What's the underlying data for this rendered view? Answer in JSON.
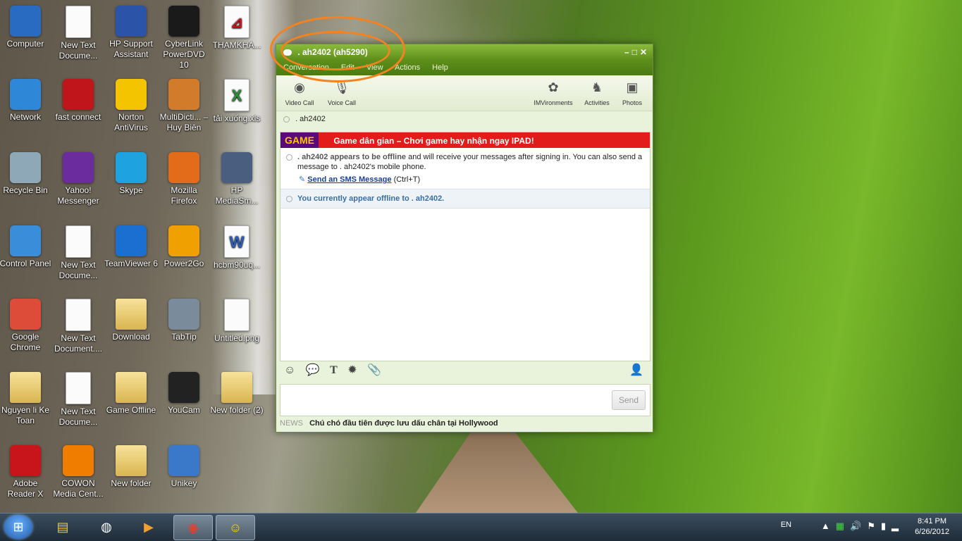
{
  "desktop": {
    "icons": [
      {
        "label": "Computer",
        "icon": "computer-icon",
        "color": "#2a6bc2"
      },
      {
        "label": "New Text Docume...",
        "icon": "text-document-icon",
        "color": "#fbfbfb"
      },
      {
        "label": "HP Support Assistant",
        "icon": "hp-support-icon",
        "color": "#2b54a8"
      },
      {
        "label": "CyberLink PowerDVD 10",
        "icon": "powerdvd-icon",
        "color": "#1a1a1a"
      },
      {
        "label": "THAMKHA...",
        "icon": "pdf-document-icon",
        "color": "#fbfbfb"
      },
      {
        "label": "Network",
        "icon": "network-icon",
        "color": "#2f87d8"
      },
      {
        "label": "fast connect",
        "icon": "fast-connect-icon",
        "color": "#c0161b"
      },
      {
        "label": "Norton AntiVirus",
        "icon": "norton-icon",
        "color": "#f5c400"
      },
      {
        "label": "MultiDicti... – Huy Biên",
        "icon": "multidictionary-icon",
        "color": "#d27b2a"
      },
      {
        "label": "tải xuống.xls",
        "icon": "excel-file-icon",
        "color": "#2e8b3a"
      },
      {
        "label": "Recycle Bin",
        "icon": "recycle-bin-icon",
        "color": "#8fa8b8"
      },
      {
        "label": "Yahoo! Messenger",
        "icon": "yahoo-messenger-icon",
        "color": "#6b2c9e"
      },
      {
        "label": "Skype",
        "icon": "skype-icon",
        "color": "#1ea2e0"
      },
      {
        "label": "Mozilla Firefox",
        "icon": "firefox-icon",
        "color": "#e36c1b"
      },
      {
        "label": "HP MediaSm...",
        "icon": "hp-mediasmart-icon",
        "color": "#4a5e80"
      },
      {
        "label": "Control Panel",
        "icon": "control-panel-icon",
        "color": "#3a8dd8"
      },
      {
        "label": "New Text Docume...",
        "icon": "text-document-icon",
        "color": "#fbfbfb"
      },
      {
        "label": "TeamViewer 6",
        "icon": "teamviewer-icon",
        "color": "#1b6fd1"
      },
      {
        "label": "Power2Go",
        "icon": "power2go-icon",
        "color": "#f0a000"
      },
      {
        "label": "hcbm90uq...",
        "icon": "word-file-icon",
        "color": "#2b5cb8"
      },
      {
        "label": "Google Chrome",
        "icon": "chrome-icon",
        "color": "#dd4b39"
      },
      {
        "label": "New Text Document....",
        "icon": "text-document-icon",
        "color": "#fbfbfb"
      },
      {
        "label": "Download",
        "icon": "folder-icon",
        "color": "#e5c560"
      },
      {
        "label": "TabTip",
        "icon": "tabtip-icon",
        "color": "#7a8c9c"
      },
      {
        "label": "Untitled.png",
        "icon": "image-file-icon",
        "color": "#f0f0f0"
      },
      {
        "label": "Nguyen li Ke Toan",
        "icon": "folder-icon",
        "color": "#e5c560"
      },
      {
        "label": "New Text Docume...",
        "icon": "text-document-icon",
        "color": "#fbfbfb"
      },
      {
        "label": "Game Offline",
        "icon": "folder-icon",
        "color": "#e5c560"
      },
      {
        "label": "YouCam",
        "icon": "youcam-icon",
        "color": "#222222"
      },
      {
        "label": "New folder (2)",
        "icon": "folder-icon",
        "color": "#e5c560"
      },
      {
        "label": "Adobe Reader X",
        "icon": "adobe-reader-icon",
        "color": "#c8141b"
      },
      {
        "label": "COWON Media Cent...",
        "icon": "cowon-icon",
        "color": "#f07d00"
      },
      {
        "label": "New folder",
        "icon": "folder-icon",
        "color": "#e5c560"
      },
      {
        "label": "Unikey",
        "icon": "unikey-icon",
        "color": "#3a78c9"
      }
    ]
  },
  "messenger": {
    "title": ". ah2402 (ah5290)",
    "menu": [
      "Conversation",
      "Edit",
      "View",
      "Actions",
      "Help"
    ],
    "toolbar": {
      "video_call": "Video Call",
      "voice_call": "Voice Call",
      "imvironments": "IMVironments",
      "activities": "Activities",
      "photos": "Photos"
    },
    "contact_name": ". ah2402",
    "ad": {
      "logo": "GAME",
      "text": "Game dân gian – Chơi game hay nhận ngay IPAD!"
    },
    "offline_notice": {
      "name_part": ". ah2402 appears to be offline",
      "rest": " and will receive your messages after signing in. You can also send a message to . ah2402's mobile phone.",
      "sms_link": "Send an SMS Message",
      "sms_shortcut": "(Ctrl+T)"
    },
    "status_line": "You currently appear offline to . ah2402.",
    "input": {
      "value": "",
      "placeholder": ""
    },
    "send_label": "Send",
    "news": {
      "label": "NEWS",
      "text": "Chú chó đầu tiên được lưu dấu chân tại Hollywood"
    }
  },
  "taskbar": {
    "start_label": "Start",
    "items": [
      {
        "icon": "windows-explorer-icon",
        "active": false
      },
      {
        "icon": "ea-games-icon",
        "active": false
      },
      {
        "icon": "media-player-icon",
        "active": false
      },
      {
        "icon": "chrome-icon",
        "active": true
      },
      {
        "icon": "yahoo-messenger-icon",
        "active": true
      }
    ],
    "language": "EN",
    "time": "8:41 PM",
    "date": "6/26/2012"
  },
  "colors": {
    "messenger_green": "#5e8f1b",
    "annotation_orange": "#f58220",
    "ad_red": "#e21b1b"
  }
}
